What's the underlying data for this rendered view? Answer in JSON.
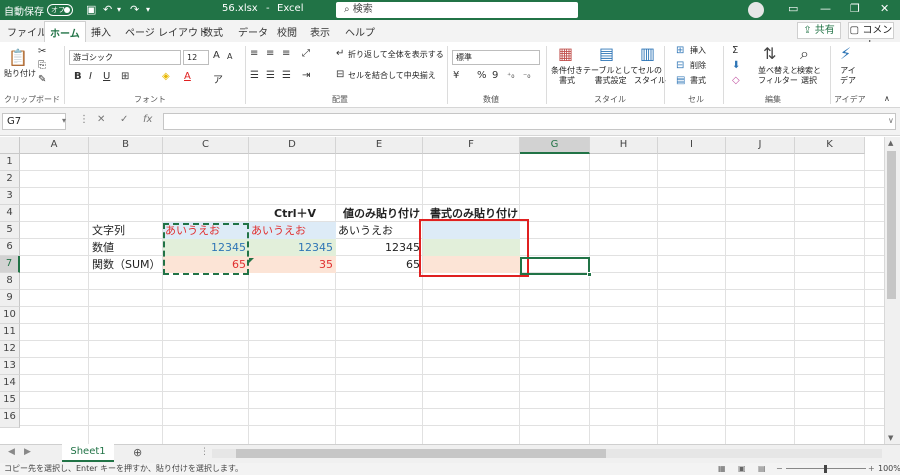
{
  "titlebar": {
    "autosave_label": "自動保存",
    "autosave_state": "オフ",
    "filename": "56.xlsx",
    "separator": "-",
    "app_name": "Excel",
    "search_placeholder": "検索"
  },
  "tabs": [
    "ファイル",
    "ホーム",
    "挿入",
    "ページ レイアウト",
    "数式",
    "データ",
    "校閲",
    "表示",
    "ヘルプ"
  ],
  "share_label": "共有",
  "comment_label": "コメント",
  "ribbon": {
    "clipboard": {
      "paste": "貼り付け",
      "group": "クリップボード"
    },
    "font": {
      "name": "游ゴシック",
      "size": "12",
      "bold": "B",
      "italic": "I",
      "underline": "U",
      "font_color": "A",
      "grow": "A",
      "shrink": "A",
      "group": "フォント"
    },
    "alignment": {
      "wrap": "折り返して全体を表示する",
      "merge": "セルを結合して中央揃え",
      "group": "配置"
    },
    "number": {
      "format": "標準",
      "percent": "%",
      "comma": "9",
      "group": "数値"
    },
    "styles": {
      "conditional": "条件付き\n書式",
      "table": "テーブルとして\n書式設定",
      "cell": "セルの\nスタイル",
      "group": "スタイル"
    },
    "cells": {
      "insert": "挿入",
      "delete": "削除",
      "format": "書式",
      "group": "セル"
    },
    "editing": {
      "sort": "並べ替えと\nフィルター",
      "find": "検索と\n選択",
      "group": "編集"
    },
    "ideas": {
      "label": "アイ\nデア",
      "group": "アイデア"
    }
  },
  "formula_bar": {
    "name_box": "G7",
    "fx": "fx",
    "cancel": "✕",
    "enter": "✓",
    "content": ""
  },
  "columns": [
    "A",
    "B",
    "C",
    "D",
    "E",
    "F",
    "G",
    "H",
    "I",
    "J",
    "K"
  ],
  "rows": [
    "1",
    "2",
    "3",
    "4",
    "5",
    "6",
    "7",
    "8",
    "9",
    "10",
    "11",
    "12",
    "13",
    "14",
    "15",
    "16"
  ],
  "cells": {
    "D4": "Ctrl＋V",
    "E4": "値のみ貼り付け",
    "F4": "書式のみ貼り付け",
    "B5": "文字列",
    "C5": "あいうえお",
    "D5": "あいうえお",
    "E5": "あいうえお",
    "B6": "数値",
    "C6": "12345",
    "D6": "12345",
    "E6": "12345",
    "B7": "関数（SUM）",
    "C7": "65",
    "D7": "35",
    "E7": "65"
  },
  "sheet_tab": "Sheet1",
  "status": {
    "message": "コピー先を選択し、Enter キーを押すか、貼り付けを選択します。",
    "zoom": "100%"
  },
  "colors": {
    "accent": "#217346",
    "highlight": "#e02020",
    "fill_blue": "#ddebf7",
    "fill_green": "#e2efda",
    "fill_red": "#fce4d6"
  }
}
